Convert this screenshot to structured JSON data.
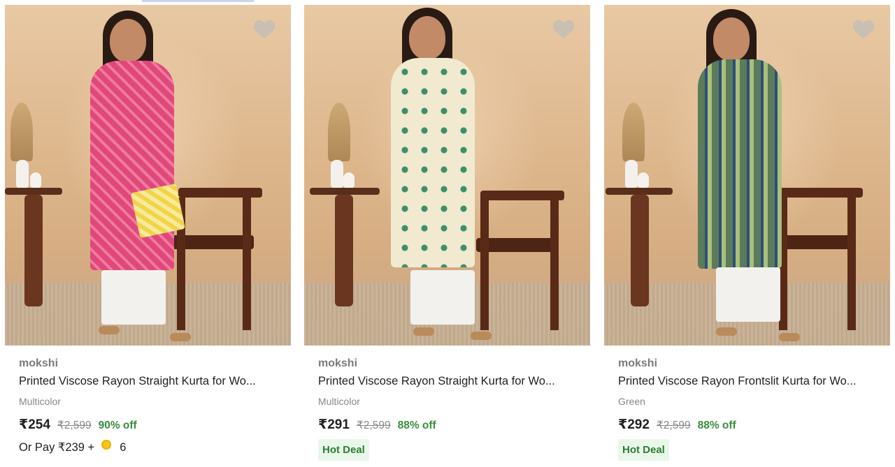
{
  "products": [
    {
      "brand": "mokshi",
      "title": "Printed Viscose Rayon Straight Kurta for Wo...",
      "color": "Multicolor",
      "price": "₹254",
      "mrp": "₹2,599",
      "discount": "90% off",
      "pay_prefix": "Or Pay ₹239 +",
      "coins": "6",
      "kurta_color": "#e0487a",
      "has_clutch": true
    },
    {
      "brand": "mokshi",
      "title": "Printed Viscose Rayon Straight Kurta for Wo...",
      "color": "Multicolor",
      "price": "₹291",
      "mrp": "₹2,599",
      "discount": "88% off",
      "badge": "Hot Deal",
      "kurta_color": "#f1ead0",
      "has_clutch": false
    },
    {
      "brand": "mokshi",
      "title": "Printed Viscose Rayon Frontslit Kurta for Wo...",
      "color": "Green",
      "price": "₹292",
      "mrp": "₹2,599",
      "discount": "88% off",
      "badge": "Hot Deal",
      "kurta_color": "#5b7b5a",
      "has_clutch": false
    }
  ],
  "icons": {
    "wishlist": "heart-icon",
    "coin": "supercoin-icon"
  },
  "colors": {
    "discount": "#388e3c",
    "hot_deal_bg": "#e9f7ea",
    "hot_deal_text": "#2e7d32"
  }
}
